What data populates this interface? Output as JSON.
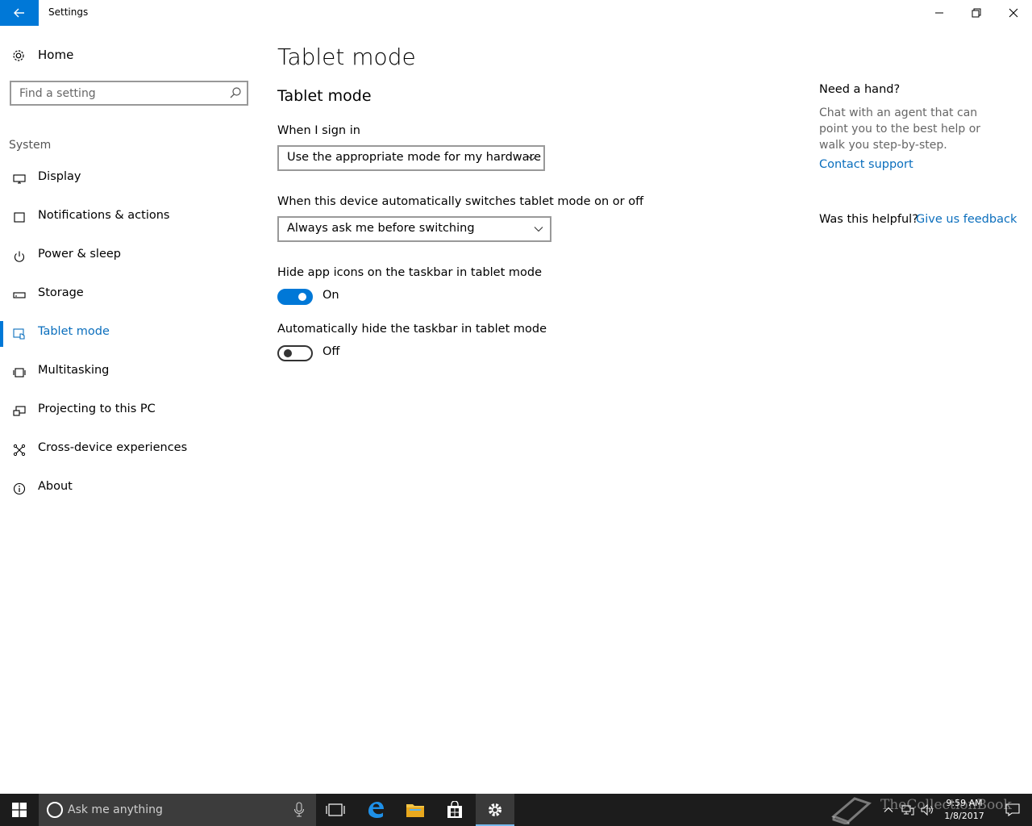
{
  "window": {
    "title": "Settings"
  },
  "sidebar": {
    "home_label": "Home",
    "search_placeholder": "Find a setting",
    "section_label": "System",
    "items": [
      {
        "label": "Display",
        "icon": "display-icon"
      },
      {
        "label": "Notifications & actions",
        "icon": "notifications-icon"
      },
      {
        "label": "Power & sleep",
        "icon": "power-icon"
      },
      {
        "label": "Storage",
        "icon": "storage-icon"
      },
      {
        "label": "Tablet mode",
        "icon": "tablet-mode-icon",
        "active": true
      },
      {
        "label": "Multitasking",
        "icon": "multitasking-icon"
      },
      {
        "label": "Projecting to this PC",
        "icon": "projecting-icon"
      },
      {
        "label": "Cross-device experiences",
        "icon": "cross-device-icon"
      },
      {
        "label": "About",
        "icon": "info-icon"
      }
    ]
  },
  "main": {
    "page_title": "Tablet mode",
    "section_title": "Tablet mode",
    "sign_in_label": "When I sign in",
    "sign_in_value": "Use the appropriate mode for my hardware",
    "auto_switch_label": "When this device automatically switches tablet mode on or off",
    "auto_switch_value": "Always ask me before switching",
    "hide_icons_label": "Hide app icons on the taskbar in tablet mode",
    "hide_icons_state": "On",
    "hide_icons_on": true,
    "hide_taskbar_label": "Automatically hide the taskbar in tablet mode",
    "hide_taskbar_state": "Off",
    "hide_taskbar_on": false
  },
  "help": {
    "title": "Need a hand?",
    "text": "Chat with an agent that can point you to the best help or walk you step-by-step.",
    "link": "Contact support",
    "helpful_question": "Was this helpful?",
    "feedback_link": "Give us feedback"
  },
  "taskbar": {
    "search_placeholder": "Ask me anything",
    "time": "9:59 AM",
    "date": "1/8/2017",
    "watermark": "TheCollectionBook"
  },
  "colors": {
    "accent": "#0078d7",
    "link": "#0a6ebd",
    "taskbar": "#1c1c1c"
  }
}
